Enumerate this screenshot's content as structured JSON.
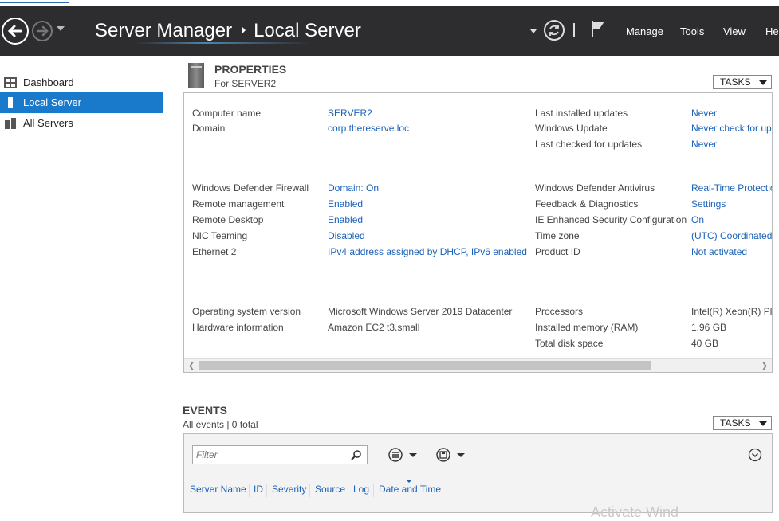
{
  "header": {
    "breadcrumb": [
      "Server Manager",
      "Local Server"
    ],
    "menu": [
      "Manage",
      "Tools",
      "View",
      "Help"
    ]
  },
  "sidebar": {
    "items": [
      {
        "label": "Dashboard",
        "active": false
      },
      {
        "label": "Local Server",
        "active": true
      },
      {
        "label": "All Servers",
        "active": false
      }
    ]
  },
  "properties": {
    "title": "PROPERTIES",
    "subtitle": "For SERVER2",
    "tasks_label": "TASKS",
    "left": [
      {
        "label": "Computer name",
        "value": "SERVER2"
      },
      {
        "label": "Domain",
        "value": "corp.thereserve.loc"
      },
      {
        "label": "Windows Defender Firewall",
        "value": "Domain: On"
      },
      {
        "label": "Remote management",
        "value": "Enabled"
      },
      {
        "label": "Remote Desktop",
        "value": "Enabled"
      },
      {
        "label": "NIC Teaming",
        "value": "Disabled"
      },
      {
        "label": "Ethernet 2",
        "value": "IPv4 address assigned by DHCP, IPv6 enabled"
      },
      {
        "label": "Operating system version",
        "value": "Microsoft Windows Server 2019 Datacenter"
      },
      {
        "label": "Hardware information",
        "value": "Amazon EC2 t3.small"
      }
    ],
    "right": [
      {
        "label": "Last installed updates",
        "value": "Never"
      },
      {
        "label": "Windows Update",
        "value": "Never check for up"
      },
      {
        "label": "Last checked for updates",
        "value": "Never"
      },
      {
        "label": "Windows Defender Antivirus",
        "value": "Real-Time Protectio"
      },
      {
        "label": "Feedback & Diagnostics",
        "value": "Settings"
      },
      {
        "label": "IE Enhanced Security Configuration",
        "value": "On"
      },
      {
        "label": "Time zone",
        "value": "(UTC) Coordinated"
      },
      {
        "label": "Product ID",
        "value": "Not activated"
      },
      {
        "label": "Processors",
        "value": "Intel(R) Xeon(R) Pla"
      },
      {
        "label": "Installed memory (RAM)",
        "value": "1.96 GB"
      },
      {
        "label": "Total disk space",
        "value": "40 GB"
      }
    ]
  },
  "events": {
    "title": "EVENTS",
    "subtitle": "All events | 0 total",
    "tasks_label": "TASKS",
    "filter_placeholder": "Filter",
    "columns": [
      "Server Name",
      "ID",
      "Severity",
      "Source",
      "Log",
      "Date and Time"
    ]
  },
  "watermark": "Activate Wind"
}
